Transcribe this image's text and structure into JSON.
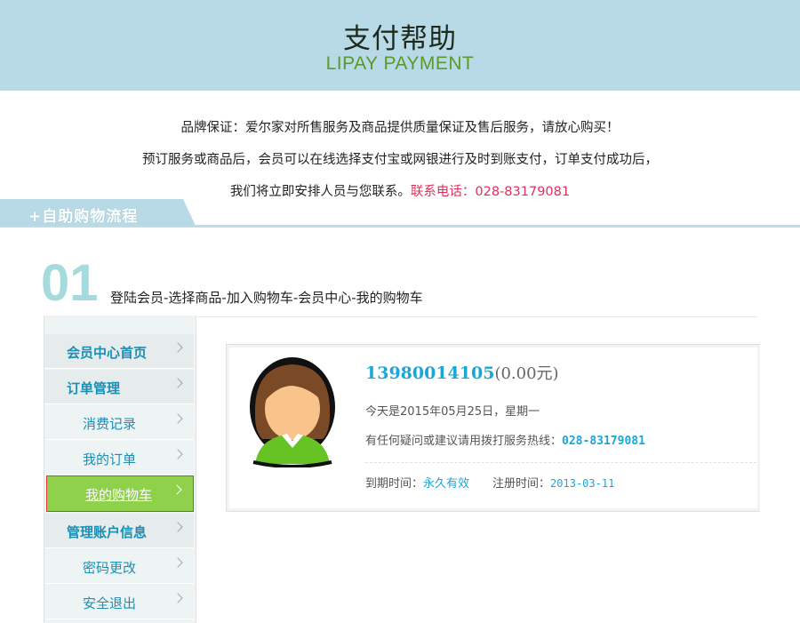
{
  "header": {
    "title": "支付帮助",
    "subtitle": "LIPAY PAYMENT"
  },
  "intro": {
    "line1": "品牌保证：爱尔家对所售服务及商品提供质量保证及售后服务，请放心购买！",
    "line2": "预订服务或商品后，会员可以在线选择支付宝或网银进行及时到账支付，订单支付成功后，",
    "line3_prefix": "我们将立即安排人员与您联系。",
    "line3_hotline": "联系电话：028-83179081"
  },
  "flow": {
    "tab_label": "+自助购物流程"
  },
  "step": {
    "number": "01",
    "text": "登陆会员-选择商品-加入购物车-会员中心-我的购物车"
  },
  "sidebar": {
    "items": [
      {
        "label": "会员中心首页",
        "type": "group"
      },
      {
        "label": "订单管理",
        "type": "group"
      },
      {
        "label": "消费记录",
        "type": "sub"
      },
      {
        "label": "我的订单",
        "type": "sub"
      },
      {
        "label": "我的购物车",
        "type": "sub",
        "active": true
      },
      {
        "label": "管理账户信息",
        "type": "group"
      },
      {
        "label": "密码更改",
        "type": "sub"
      },
      {
        "label": "安全退出",
        "type": "sub"
      }
    ]
  },
  "profile": {
    "account": "13980014105",
    "balance": "(0.00元)",
    "today": "今天是2015年05月25日，星期一",
    "hotline_prefix": "有任何疑问或建议请用拨打服务热线：",
    "hotline": "028-83179081",
    "expire_label": "到期时间：",
    "expire_value": "永久有效",
    "register_label": "注册时间：",
    "register_value": "2013-03-11"
  },
  "colors": {
    "header_bg": "#b8d9e6",
    "subtitle": "#5a9a2a",
    "hotline": "#e0305a",
    "link_blue": "#1aa7d8",
    "active_green": "#8fd14b"
  }
}
